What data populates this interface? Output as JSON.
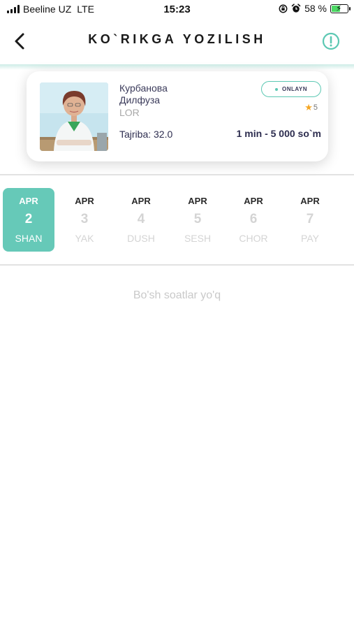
{
  "status_bar": {
    "carrier": "Beeline UZ",
    "network": "LTE",
    "time": "15:23",
    "battery_percent": "58 %",
    "battery_level": 0.58
  },
  "header": {
    "title": "KO`RIKGA YOZILISH",
    "back_icon": "chevron-left-icon",
    "info_icon": "exclamation-circle-icon"
  },
  "doctor": {
    "surname": "Курбанова",
    "first_name": "Дилфуза",
    "specialty": "LOR",
    "experience": "Tajriba: 32.0",
    "status": "ONLAYN",
    "rating": "5",
    "price": "1 min - 5 000 so`m"
  },
  "dates": [
    {
      "month": "APR",
      "day": "2",
      "weekday": "SHAN",
      "selected": true
    },
    {
      "month": "APR",
      "day": "3",
      "weekday": "YAK",
      "selected": false
    },
    {
      "month": "APR",
      "day": "4",
      "weekday": "DUSH",
      "selected": false
    },
    {
      "month": "APR",
      "day": "5",
      "weekday": "SESH",
      "selected": false
    },
    {
      "month": "APR",
      "day": "6",
      "weekday": "CHOR",
      "selected": false
    },
    {
      "month": "APR",
      "day": "7",
      "weekday": "PAY",
      "selected": false
    }
  ],
  "empty_slots_message": "Bo'sh soatlar yo'q",
  "colors": {
    "accent": "#66c9b8",
    "star": "#f5a623",
    "text_dark": "#2d2d4f",
    "text_muted": "#c9c9c9"
  }
}
